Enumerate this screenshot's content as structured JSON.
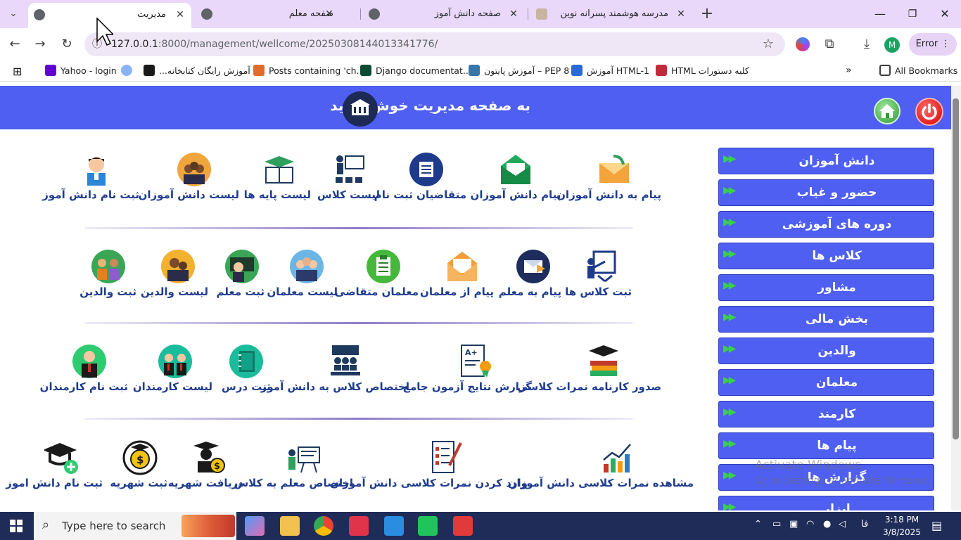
{
  "browser": {
    "tabs": [
      {
        "title": "مدیریت",
        "active": true
      },
      {
        "title": "صفحه معلم",
        "active": false
      },
      {
        "title": "صفحه دانش آموز",
        "active": false
      },
      {
        "title": "مدرسه هوشمند پسرانه نوین",
        "active": false
      }
    ],
    "url_host": "127.0.0.1",
    "url_rest": ":8000/management/wellcome/20250308144013341776/",
    "profile_initial": "M",
    "error_label": "Error",
    "bookmarks": [
      "Yahoo - login",
      "آموزش رایگان کتابخانه...",
      "Posts containing 'ch...",
      "Django documentat...",
      "PEP 8 – آموزش پایتون",
      "HTML-1 آموزش",
      "کلیه دستورات HTML"
    ],
    "all_bookmarks": "All Bookmarks"
  },
  "banner": {
    "title": "به صفحه مدیریت خوش آمدید"
  },
  "grid": {
    "row1": [
      "پیام به دانش آموزان",
      "پیام دانش آموزان",
      "متقاضیان ثبت نام",
      "لیست کلاس",
      "لیست پایه ها",
      "لیست دانش آموزان",
      "ثبت نام دانش آموز"
    ],
    "row2": [
      "ثبت کلاس ها",
      "پیام به معلم",
      "پیام از معلمان",
      "معلمان متقاضی",
      "لیست معلمان",
      "ثبت معلم",
      "لیست والدین",
      "ثبت والدین"
    ],
    "row3": [
      "صدور کارنامه نمرات کلاسی",
      "گزارش نتایج آزمون جامع",
      "اختصاص کلاس به دانش آموز",
      "ثبت درس",
      "لیست کارمندان",
      "ثبت نام کارمندان"
    ],
    "row4": [
      "مشاهده نمرات کلاسی دانش آموزان",
      "وارد کردن نمرات کلاسی دانش آموزان",
      "اختصاص معلم به کلاس",
      "دریافت شهریه",
      "ثبت شهریه",
      "ثبت نام دانش اموز"
    ]
  },
  "sidebar": {
    "items": [
      "دانش آموزان",
      "حضور و غیاب",
      "دوره های آموزشی",
      "کلاس ها",
      "مشاور",
      "بخش مالی",
      "والدین",
      "معلمان",
      "کارمند",
      "پیام ها",
      "گزارش ها",
      "ابزار"
    ]
  },
  "watermark": {
    "line1": "Activate Windows",
    "line2": "Go to Settings to activate Windows."
  },
  "taskbar": {
    "search_placeholder": "Type here to search",
    "lang": "فا",
    "time": "3:18 PM",
    "date": "3/8/2025"
  }
}
